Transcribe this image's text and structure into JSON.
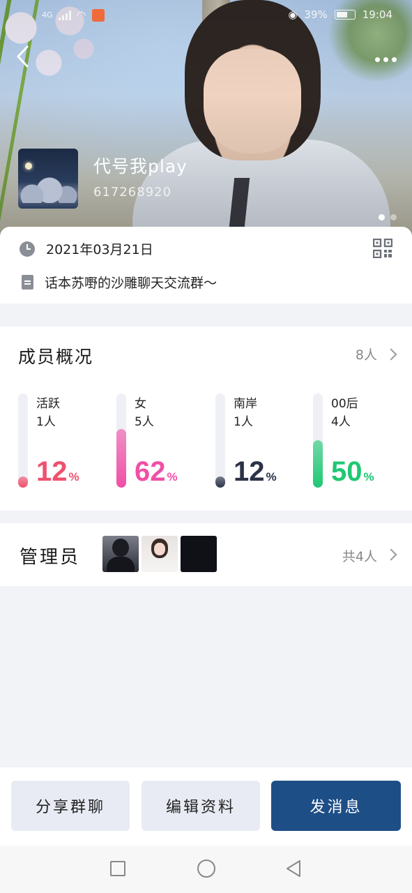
{
  "status_bar": {
    "network": "4G",
    "battery_percent": "39%",
    "time": "19:04"
  },
  "header": {
    "group_name": "代号我play",
    "group_id": "617268920",
    "page_indicator": {
      "count": 2,
      "active": 1
    }
  },
  "info": {
    "created_date": "2021年03月21日",
    "description": "话本苏嘢的沙雕聊天交流群～"
  },
  "members": {
    "title": "成员概况",
    "count_label": "8人",
    "stats": [
      {
        "label": "活跃",
        "count": "1人",
        "percent": "12",
        "fraction": 0.12,
        "color": "#f0506e"
      },
      {
        "label": "女",
        "count": "5人",
        "percent": "62",
        "fraction": 0.62,
        "color": "#f04fa6"
      },
      {
        "label": "南岸",
        "count": "1人",
        "percent": "12",
        "fraction": 0.12,
        "color": "#2b3247"
      },
      {
        "label": "00后",
        "count": "4人",
        "percent": "50",
        "fraction": 0.5,
        "color": "#1fc873"
      }
    ],
    "percent_unit": "%"
  },
  "admins": {
    "title": "管理员",
    "count_label": "共4人"
  },
  "actions": {
    "share_label": "分享群聊",
    "edit_label": "编辑资料",
    "send_label": "发消息"
  },
  "colors": {
    "primary": "#1e4e86",
    "secondary_button": "#e8ebf4",
    "background": "#f2f3f7"
  }
}
